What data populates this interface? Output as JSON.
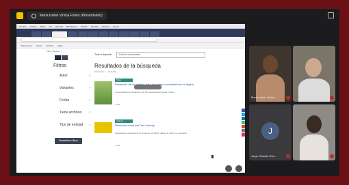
{
  "meeting": {
    "presenter_label": "Maria Isabel Vinicia Flores (Presentando)"
  },
  "browser": {
    "menu_items": [
      "Chrome",
      "Archivo",
      "Editar",
      "Ver",
      "Historial",
      "Marcadores",
      "Perfiles",
      "Pestaña",
      "Ventana",
      "Ayuda"
    ],
    "address": "",
    "bookmarks": [
      "Aplicaciones",
      "Gmail",
      "YouTube",
      "Maps"
    ]
  },
  "page": {
    "breadcrumb": "Inicio / Buscar",
    "filters_title": "Filtros",
    "filters": [
      {
        "label": "Autor"
      },
      {
        "label": "Variantes"
      },
      {
        "label": "Fecha"
      },
      {
        "label": "Tiene archivos"
      },
      {
        "label": "Tipo de entidad"
      }
    ],
    "filter_button": "Restablecer filtros",
    "search_scope": "Todo el depósito",
    "search_query": "turismo comunitario",
    "results_title": "Resultados de la búsqueda",
    "results_count": "Mostrando 1 - 10 de 56",
    "results": [
      {
        "tag": "Tesis",
        "title": "Desarrollo de un modelo para el turismo comunitario en la región",
        "meta": "Universidad de Investigación de Tecnología Experimental Yachay",
        "more": "+ Ver"
      },
      {
        "tag": "Artículo",
        "title": "Resumen anual del Tren Yachay",
        "meta": "Presentación realizada el 21 de agosto de 2020, relativa al turismo en la región",
        "more": "+ Ver"
      }
    ]
  },
  "participants": [
    {
      "name": "Maria Isabel Vinicia..."
    },
    {
      "name": ""
    },
    {
      "name": "Jorge Orlando Gon...",
      "initial": "J"
    },
    {
      "name": ""
    }
  ]
}
